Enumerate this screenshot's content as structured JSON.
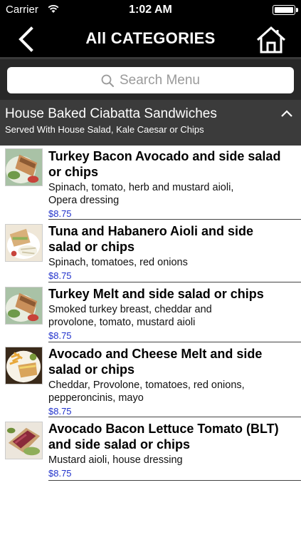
{
  "status_bar": {
    "carrier": "Carrier",
    "time": "1:02 AM"
  },
  "nav": {
    "title": "All CATEGORIES",
    "back_icon": "chevron-left-icon",
    "home_icon": "home-icon"
  },
  "search": {
    "placeholder": "Search Menu",
    "icon": "search-icon"
  },
  "category": {
    "title": "House Baked Ciabatta Sandwiches",
    "subtitle": "Served With House Salad, Kale Caesar or Chips",
    "collapse_icon": "chevron-up-icon"
  },
  "items": [
    {
      "name_line1": "Turkey Bacon Avocado and side salad",
      "name_line2": "or chips",
      "desc_line1": "Spinach, tomato, herb and mustard aioli,",
      "desc_line2": "Opera dressing",
      "desc_line3": "",
      "price": "$8.75"
    },
    {
      "name_line1": "Tuna and Habanero Aioli and side",
      "name_line2": "salad or chips",
      "desc_line1": "Spinach, tomatoes, red onions",
      "desc_line2": "",
      "desc_line3": "",
      "price": "$8.75"
    },
    {
      "name_line1": "Turkey Melt and side salad or chips",
      "name_line2": "",
      "desc_line1": "Smoked turkey breast, cheddar and",
      "desc_line2": "provolone, tomato,  mustard aioli",
      "desc_line3": "",
      "price": "$8.75"
    },
    {
      "name_line1": "Avocado and Cheese Melt and side",
      "name_line2": "salad or chips",
      "desc_line1": "Cheddar, Provolone, tomatoes, red onions,",
      "desc_line2": "pepperoncinis, mayo",
      "desc_line3": "",
      "price": "$8.75"
    },
    {
      "name_line1": "Avocado Bacon Lettuce Tomato (BLT)",
      "name_line2": "and side salad or chips",
      "desc_line1": "Mustard aioli, house dressing",
      "desc_line2": "",
      "desc_line3": "",
      "price": "$8.75"
    }
  ]
}
